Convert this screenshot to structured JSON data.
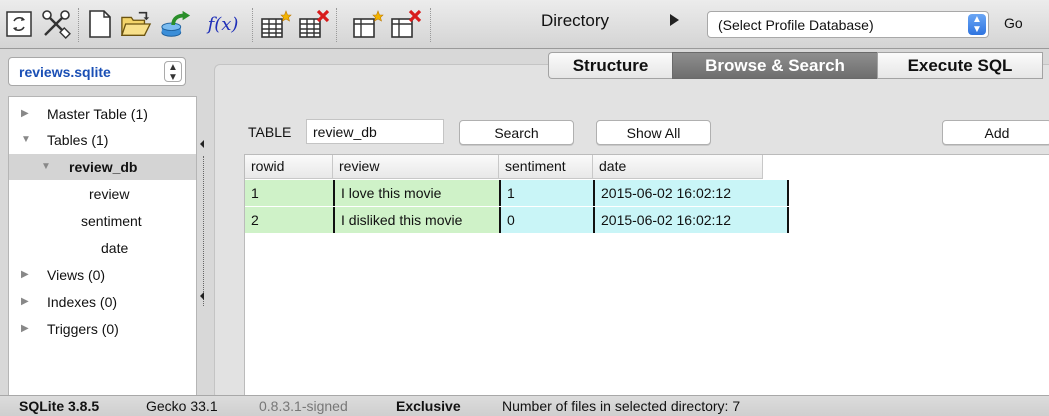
{
  "toolbar": {
    "icons": [
      "refresh-icon",
      "tools-icon",
      "new-file-icon",
      "open-folder-icon",
      "export-icon",
      "function-icon",
      "new-table-icon",
      "delete-table-icon",
      "new-index-icon",
      "delete-index-icon"
    ],
    "function_label": "f(x)",
    "directory_label": "Directory",
    "profile_select": "(Select Profile Database)",
    "go_label": "Go"
  },
  "sidebar": {
    "database_select": "reviews.sqlite",
    "tree": [
      {
        "label": "Master Table (1)",
        "expanded": false,
        "level": 0
      },
      {
        "label": "Tables (1)",
        "expanded": true,
        "level": 0
      },
      {
        "label": "review_db",
        "expanded": true,
        "level": 1,
        "selected": true
      },
      {
        "label": "review",
        "level": 2
      },
      {
        "label": "sentiment",
        "level": 2
      },
      {
        "label": "date",
        "level": 2
      },
      {
        "label": "Views (0)",
        "expanded": false,
        "level": 0
      },
      {
        "label": "Indexes (0)",
        "expanded": false,
        "level": 0
      },
      {
        "label": "Triggers (0)",
        "expanded": false,
        "level": 0
      }
    ]
  },
  "tabs": [
    {
      "label": "Structure",
      "active": false
    },
    {
      "label": "Browse & Search",
      "active": true
    },
    {
      "label": "Execute SQL",
      "active": false
    }
  ],
  "browse": {
    "table_label": "TABLE",
    "table_value": "review_db",
    "search_label": "Search",
    "show_all_label": "Show All",
    "add_label": "Add",
    "columns": [
      "rowid",
      "review",
      "sentiment",
      "date"
    ],
    "rows": [
      [
        "1",
        "I love this movie",
        "1",
        "2015-06-02 16:02:12"
      ],
      [
        "2",
        "I disliked this movie",
        "0",
        "2015-06-02 16:02:12"
      ]
    ]
  },
  "status": {
    "sqlite_version": "SQLite 3.8.5",
    "gecko_version": "Gecko 33.1",
    "addon_version": "0.8.3.1-signed",
    "mode": "Exclusive",
    "files_info": "Number of files in selected directory: 7"
  },
  "colors": {
    "active_tab": "#7a7a7a",
    "row_green": "#cff2c8",
    "row_cyan": "#c9f5f7",
    "db_select_text": "#1a4fb5"
  }
}
